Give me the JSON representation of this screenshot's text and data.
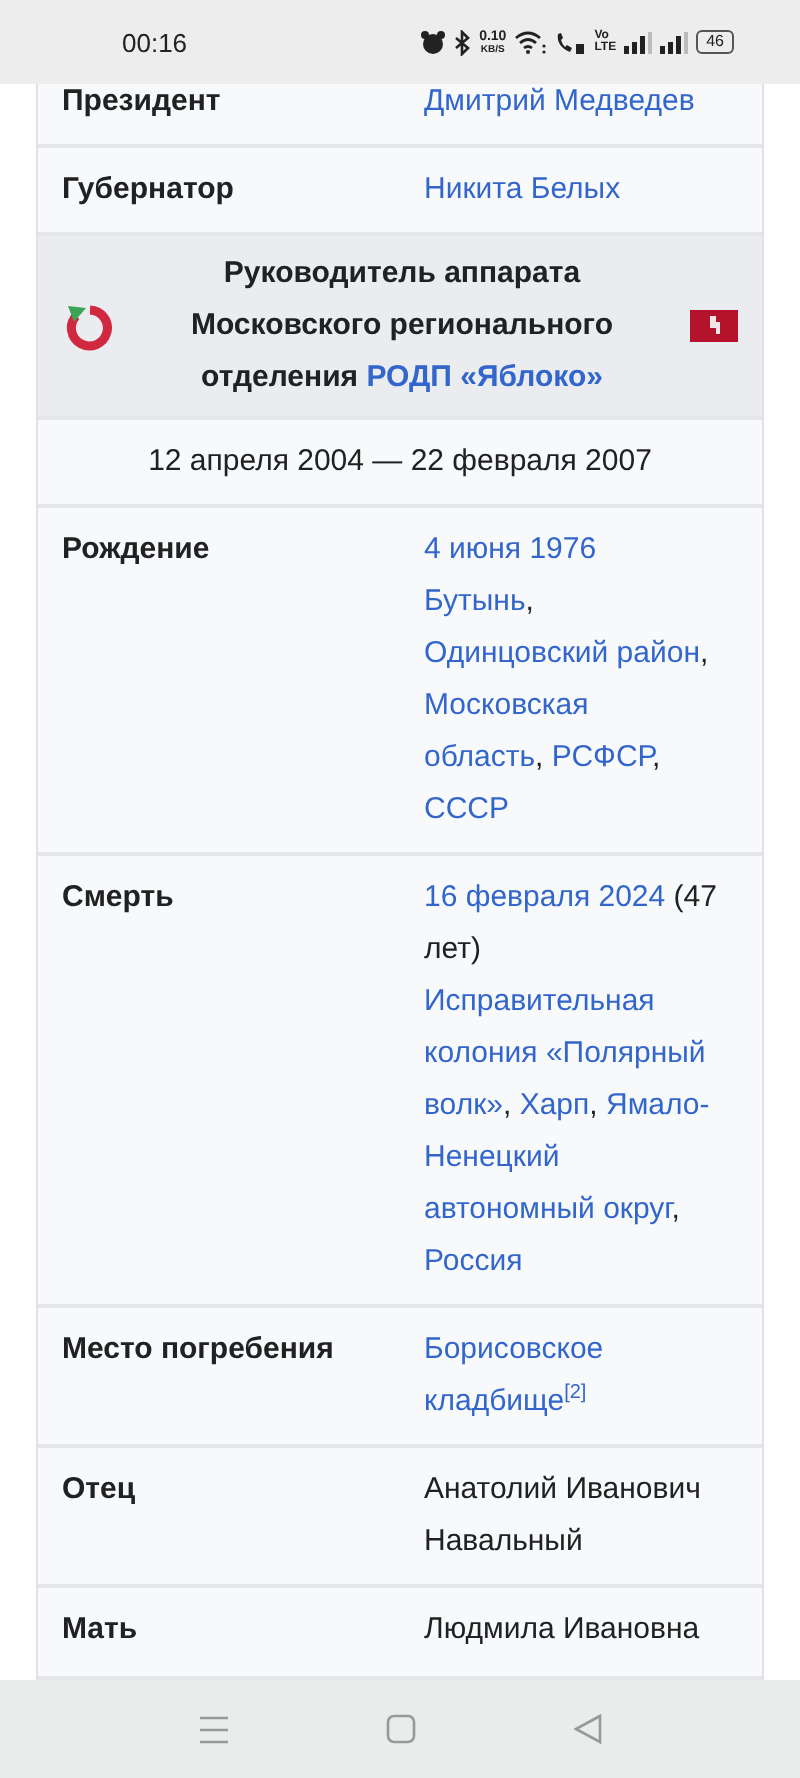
{
  "status_bar": {
    "time": "00:16",
    "net_speed": "0.10",
    "net_unit": "KB/S",
    "volte": "Vo",
    "lte": "LTE",
    "battery": "46"
  },
  "rows": [
    {
      "kind": "field",
      "label": "Президент",
      "value": [
        [
          {
            "kind": "link",
            "text": "Дмитрий Медведев"
          }
        ]
      ]
    },
    {
      "kind": "field",
      "label": "Губернатор",
      "value": [
        [
          {
            "kind": "link",
            "text": "Никита Белых"
          }
        ]
      ]
    },
    {
      "kind": "header",
      "text": "Руководитель аппарата Московского регионального отделения ",
      "link": "РОДП «Яблоко»"
    },
    {
      "kind": "dates",
      "text": "12 апреля 2004 — 22 февраля 2007"
    },
    {
      "kind": "field",
      "label": "Рождение",
      "value": [
        [
          {
            "kind": "link",
            "text": "4 июня 1976"
          }
        ],
        [
          {
            "kind": "link",
            "text": "Бутынь"
          },
          {
            "kind": "text",
            "text": ","
          }
        ],
        [
          {
            "kind": "link",
            "text": "Одинцовский район"
          },
          {
            "kind": "text",
            "text": ","
          }
        ],
        [
          {
            "kind": "link",
            "text": "Московская"
          }
        ],
        [
          {
            "kind": "link",
            "text": "область"
          },
          {
            "kind": "text",
            "text": ", "
          },
          {
            "kind": "link",
            "text": "РСФСР"
          },
          {
            "kind": "text",
            "text": ","
          }
        ],
        [
          {
            "kind": "link",
            "text": "СССР"
          }
        ]
      ]
    },
    {
      "kind": "field",
      "label": "Смерть",
      "value": [
        [
          {
            "kind": "link",
            "text": "16 февраля 2024"
          },
          {
            "kind": "text",
            "text": " (47"
          }
        ],
        [
          {
            "kind": "text",
            "text": "лет)"
          }
        ],
        [
          {
            "kind": "link",
            "text": "Исправительная"
          }
        ],
        [
          {
            "kind": "link",
            "text": "колония «Полярный"
          }
        ],
        [
          {
            "kind": "link",
            "text": "волк»"
          },
          {
            "kind": "text",
            "text": ", "
          },
          {
            "kind": "link",
            "text": "Харп"
          },
          {
            "kind": "text",
            "text": ", "
          },
          {
            "kind": "link",
            "text": "Ямало-"
          }
        ],
        [
          {
            "kind": "link",
            "text": "Ненецкий"
          }
        ],
        [
          {
            "kind": "link",
            "text": "автономный округ"
          },
          {
            "kind": "text",
            "text": ","
          }
        ],
        [
          {
            "kind": "link",
            "text": "Россия"
          }
        ]
      ]
    },
    {
      "kind": "field",
      "label": "Место погребения",
      "value": [
        [
          {
            "kind": "link",
            "text": "Борисовское"
          }
        ],
        [
          {
            "kind": "link",
            "text": "кладбище"
          },
          {
            "kind": "ref",
            "text": "[2]"
          }
        ]
      ]
    },
    {
      "kind": "field",
      "label": "Отец",
      "value": [
        [
          {
            "kind": "text",
            "text": "Анатолий Иванович"
          }
        ],
        [
          {
            "kind": "text",
            "text": "Навальный"
          }
        ]
      ]
    },
    {
      "kind": "field",
      "label": "Мать",
      "value": [
        [
          {
            "kind": "text",
            "text": "Людмила Ивановна"
          }
        ]
      ]
    }
  ]
}
